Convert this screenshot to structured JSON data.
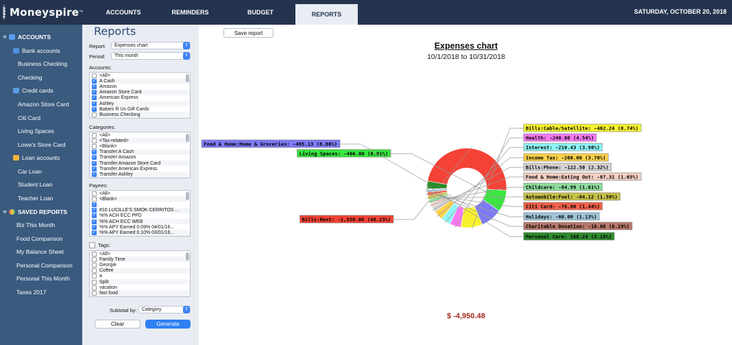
{
  "app": {
    "name": "Moneyspire",
    "tm": "™"
  },
  "tabs": [
    "ACCOUNTS",
    "REMINDERS",
    "BUDGET",
    "REPORTS"
  ],
  "active_tab": "REPORTS",
  "date": "SATURDAY, OCTOBER 20, 2018",
  "sidebar": {
    "accounts_header": "ACCOUNTS",
    "bank_header": "Bank accounts",
    "bank": [
      "Business Checking",
      "Checking"
    ],
    "cards_header": "Credit cards",
    "cards": [
      "Amazon Store Card",
      "Citi Card",
      "Living Spaces",
      "Lowe's Store Card"
    ],
    "loans_header": "Loan accounts",
    "loans": [
      "Car Loan",
      "Student Loan",
      "Teacher Loan"
    ],
    "saved_header": "SAVED REPORTS",
    "saved": [
      "Biz This Month",
      "Food Comparison",
      "My Balance Sheet",
      "Personal Comparison",
      "Personal This Month",
      "Taxes 2017"
    ]
  },
  "panel": {
    "title": "Reports",
    "report_label": "Report:",
    "report_value": "Expenses chart",
    "period_label": "Period:",
    "period_value": "This month",
    "accounts_label": "Accounts:",
    "accounts": [
      {
        "text": "<All>",
        "checked": false
      },
      {
        "text": "A Cash",
        "checked": true
      },
      {
        "text": "Amazon",
        "checked": true
      },
      {
        "text": "Amazon Store Card",
        "checked": true
      },
      {
        "text": "American Express",
        "checked": true
      },
      {
        "text": "Ashley",
        "checked": true
      },
      {
        "text": "Babies R Us Gift Cards",
        "checked": true
      },
      {
        "text": "Business Checking",
        "checked": false
      }
    ],
    "categories_label": "Categories:",
    "categories": [
      {
        "text": "<All>",
        "checked": false
      },
      {
        "text": "<Tax-related>",
        "checked": false
      },
      {
        "text": "<Blank>",
        "checked": false
      },
      {
        "text": "Transfer:A Cash",
        "checked": true
      },
      {
        "text": "Transfer:Amazon",
        "checked": true
      },
      {
        "text": "Transfer:Amazon Store Card",
        "checked": true
      },
      {
        "text": "Transfer:American Express",
        "checked": true
      },
      {
        "text": "Transfer:Ashley",
        "checked": true
      }
    ],
    "payees_label": "Payees:",
    "payees": [
      {
        "text": "<All>",
        "checked": false
      },
      {
        "text": "<Blank>",
        "checked": false
      },
      {
        "text": "",
        "checked": true
      },
      {
        "text": "#10 LUCILLE'S SMOK CERRITOS ...",
        "checked": true
      },
      {
        "text": "%% ACH ECC PPD",
        "checked": true
      },
      {
        "text": "%% ACH ECC WEB",
        "checked": true
      },
      {
        "text": "%% APY Earned 0.09% 04/01/16...",
        "checked": true
      },
      {
        "text": "%% APY Earned 0.10% 03/01/16...",
        "checked": true
      }
    ],
    "tags_label": "Tags:",
    "tags": [
      {
        "text": "<All>",
        "checked": false
      },
      {
        "text": "Family Time",
        "checked": false
      },
      {
        "text": "Georgie",
        "checked": false
      },
      {
        "text": "Coffee",
        "checked": false
      },
      {
        "text": "a",
        "checked": false
      },
      {
        "text": "Split",
        "checked": false
      },
      {
        "text": "vacation",
        "checked": false
      },
      {
        "text": "fast food",
        "checked": false
      }
    ],
    "subtotal_label": "Subtotal by:",
    "subtotal_value": "Category",
    "clear_label": "Clear",
    "generate_label": "Generate"
  },
  "report": {
    "save_label": "Save report",
    "title": "Expenses chart",
    "range": "10/1/2018 to 10/31/2018",
    "total": "$ -4,950.48"
  },
  "chart_data": {
    "type": "pie",
    "title": "Expenses chart",
    "slices": [
      {
        "label": "Bills:Rent",
        "value": -2550.0,
        "percent": 48.23,
        "color": "#f44336",
        "text": "Bills:Rent: -2,550.00 (48.23%)"
      },
      {
        "label": "Living Spaces",
        "value": -466.0,
        "percent": 8.81,
        "color": "#39e63f",
        "text": "Living Spaces: -466.00 (8.81%)"
      },
      {
        "label": "Food & Home:Home & Groceries",
        "value": -465.13,
        "percent": 8.8,
        "color": "#7d7af5",
        "text": "Food & Home:Home & Groceries: -465.13 (8.80%)"
      },
      {
        "label": "Bills:Cable/Satellite",
        "value": -462.24,
        "percent": 8.74,
        "color": "#f7f22f",
        "text": "Bills:Cable/Satellite: -462.24 (8.74%)"
      },
      {
        "label": "Health",
        "value": -240.0,
        "percent": 4.54,
        "color": "#f779f2",
        "text": "Health: -240.00 (4.54%)"
      },
      {
        "label": "Interest",
        "value": -210.43,
        "percent": 3.98,
        "color": "#8ef4f7",
        "text": "Interest: -210.43 (3.98%)"
      },
      {
        "label": "Income Tax",
        "value": -200.0,
        "percent": 3.78,
        "color": "#fbd24a",
        "text": "Income Tax: -200.00 (3.78%)"
      },
      {
        "label": "Bills:Phone",
        "value": -122.5,
        "percent": 2.32,
        "color": "#d4d4d4",
        "text": "Bills:Phone: -122.50 (2.32%)"
      },
      {
        "label": "Food & Home:Eating Out",
        "value": -87.31,
        "percent": 1.65,
        "color": "#f2cfc4",
        "text": "Food & Home:Eating Out: -87.31 (1.65%)"
      },
      {
        "label": "Childcare",
        "value": -84.99,
        "percent": 1.61,
        "color": "#8fdc9e",
        "text": "Childcare: -84.99 (1.61%)"
      },
      {
        "label": "Automobile:Fuel",
        "value": -84.12,
        "percent": 1.59,
        "color": "#c6c14a",
        "text": "Automobile:Fuel: -84.12 (1.59%)"
      },
      {
        "label": "Citi Card",
        "value": -76.0,
        "percent": 1.44,
        "color": "#f0624b",
        "text": "Citi Card: -76.00 (1.44%)"
      },
      {
        "label": "Holidays",
        "value": -60.0,
        "percent": 1.13,
        "color": "#9fc5da",
        "text": "Holidays: -60.00 (1.13%)"
      },
      {
        "label": "Charitable Donation",
        "value": -10.0,
        "percent": 0.19,
        "color": "#b8786e",
        "text": "Charitable Donation: -10.00 (0.19%)"
      },
      {
        "label": "Personal Care",
        "value": 168.24,
        "percent": 3.18,
        "color": "#2e8b2e",
        "text": "Personal Care: 168.24 (3.18%)"
      }
    ]
  }
}
